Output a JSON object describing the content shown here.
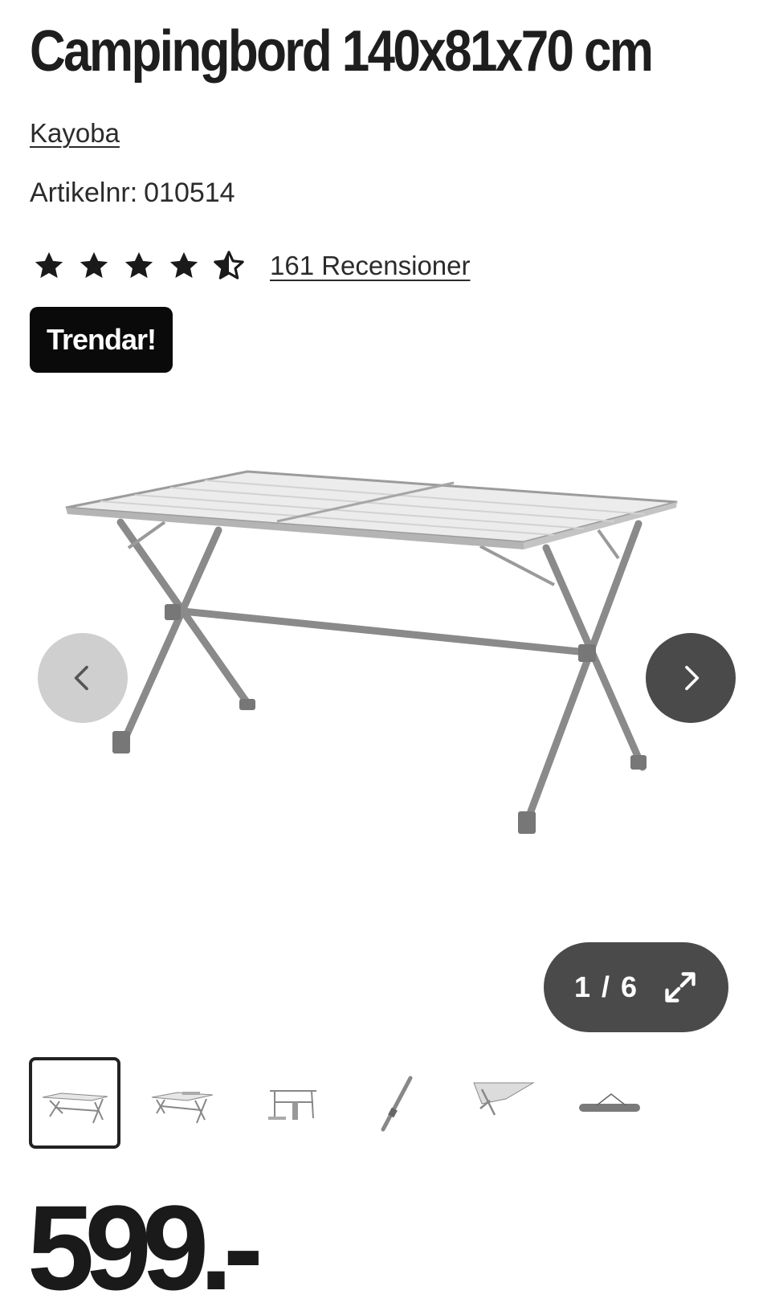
{
  "product": {
    "title": "Campingbord 140x81x70 cm",
    "brand": "Kayoba",
    "article_label": "Artikelnr:",
    "article_number": "010514",
    "rating": {
      "value": 4.5,
      "max": 5
    },
    "reviews_label": "161 Recensioner",
    "badge": "Trendar!",
    "price": "599.-"
  },
  "gallery": {
    "counter": "1 / 6",
    "current": 1,
    "total": 6,
    "thumbnails": [
      "table-front",
      "table-side",
      "table-folded",
      "leg",
      "table-detail",
      "carry-bag"
    ]
  },
  "icons": {
    "star": "star-icon",
    "half_star": "star-half-icon",
    "prev": "chevron-left-icon",
    "next": "chevron-right-icon",
    "expand": "expand-icon"
  },
  "colors": {
    "text": "#1e1e1e",
    "badge_bg": "#0a0a0a",
    "nav_dark": "#4a4a4a",
    "nav_light": "#cfcfcf"
  }
}
